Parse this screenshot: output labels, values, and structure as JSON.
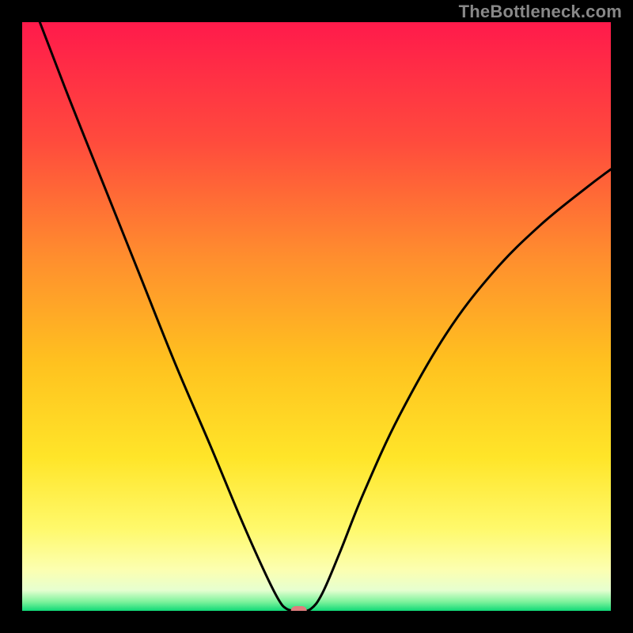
{
  "watermark": "TheBottleneck.com",
  "chart_data": {
    "type": "line",
    "title": "",
    "xlabel": "",
    "ylabel": "",
    "xlim": [
      0,
      100
    ],
    "ylim": [
      0,
      100
    ],
    "grid": false,
    "legend": false,
    "gradient_stops": [
      {
        "offset": 0.0,
        "color": "#ff1a4b"
      },
      {
        "offset": 0.2,
        "color": "#ff4a3d"
      },
      {
        "offset": 0.4,
        "color": "#ff8e2e"
      },
      {
        "offset": 0.58,
        "color": "#ffc21f"
      },
      {
        "offset": 0.74,
        "color": "#ffe529"
      },
      {
        "offset": 0.86,
        "color": "#fff96b"
      },
      {
        "offset": 0.93,
        "color": "#fcffb0"
      },
      {
        "offset": 0.965,
        "color": "#e6ffd0"
      },
      {
        "offset": 0.985,
        "color": "#7bf29b"
      },
      {
        "offset": 1.0,
        "color": "#10d977"
      }
    ],
    "series": [
      {
        "name": "curve",
        "points": [
          {
            "x": 3.0,
            "y": 100.0
          },
          {
            "x": 8.0,
            "y": 87.0
          },
          {
            "x": 14.0,
            "y": 72.0
          },
          {
            "x": 20.0,
            "y": 57.0
          },
          {
            "x": 26.0,
            "y": 42.0
          },
          {
            "x": 32.0,
            "y": 28.0
          },
          {
            "x": 37.0,
            "y": 16.0
          },
          {
            "x": 41.0,
            "y": 7.0
          },
          {
            "x": 43.5,
            "y": 2.0
          },
          {
            "x": 45.0,
            "y": 0.3
          },
          {
            "x": 47.0,
            "y": 0.0
          },
          {
            "x": 49.0,
            "y": 0.3
          },
          {
            "x": 51.0,
            "y": 3.0
          },
          {
            "x": 54.0,
            "y": 10.0
          },
          {
            "x": 58.0,
            "y": 20.0
          },
          {
            "x": 64.0,
            "y": 33.0
          },
          {
            "x": 72.0,
            "y": 47.0
          },
          {
            "x": 80.0,
            "y": 57.5
          },
          {
            "x": 88.0,
            "y": 65.5
          },
          {
            "x": 96.0,
            "y": 72.0
          },
          {
            "x": 100.0,
            "y": 75.0
          }
        ]
      }
    ],
    "marker": {
      "x": 47.0,
      "y": 0.0,
      "color": "#df7e7e"
    }
  }
}
